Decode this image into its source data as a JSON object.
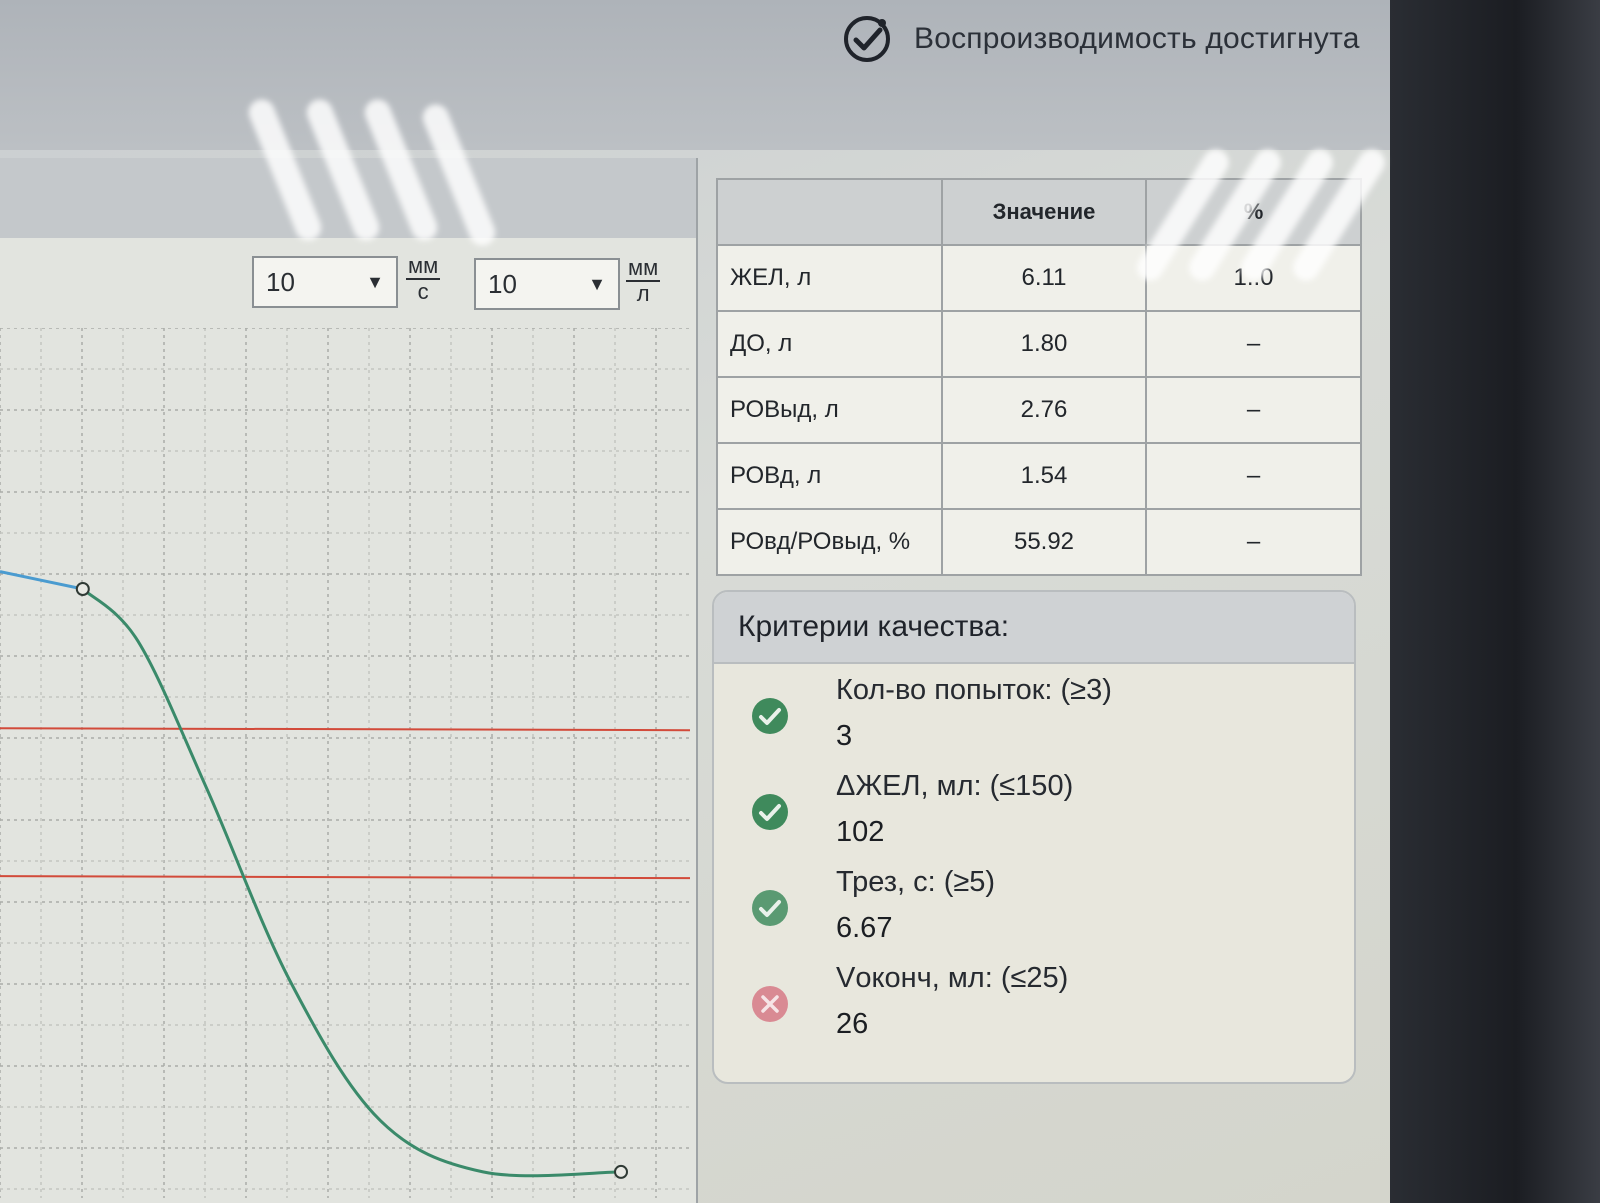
{
  "header": {
    "status_text": "Воспроизводимость достигнута",
    "status_icon": "checkmark-circle-icon"
  },
  "chart": {
    "speed_select": {
      "value": "10",
      "unit_num": "мм",
      "unit_den": "с"
    },
    "volume_select": {
      "value": "10",
      "unit_num": "мм",
      "unit_den": "л"
    }
  },
  "params_table": {
    "columns": [
      "",
      "Значение",
      "%"
    ],
    "rows": [
      {
        "name": "ЖЕЛ, л",
        "value": "6.11",
        "pct": "1..0"
      },
      {
        "name": "ДО, л",
        "value": "1.80",
        "pct": "–"
      },
      {
        "name": "РОВыд, л",
        "value": "2.76",
        "pct": "–"
      },
      {
        "name": "РОВд, л",
        "value": "1.54",
        "pct": "–"
      },
      {
        "name": "РОвд/РОвыд, %",
        "value": "55.92",
        "pct": "–"
      }
    ]
  },
  "criteria": {
    "title": "Критерии качества:",
    "items": [
      {
        "label": "Кол-во попыток: (≥3)",
        "value": "3",
        "status": "pass"
      },
      {
        "label": "ΔЖЕЛ, мл: (≤150)",
        "value": "102",
        "status": "pass"
      },
      {
        "label": "Трез, с: (≥5)",
        "value": "6.67",
        "status": "pass"
      },
      {
        "label": "Vоконч, мл: (≤25)",
        "value": "26",
        "status": "fail"
      }
    ],
    "colors": {
      "pass": "#3f8a5c",
      "fail": "#d98a93"
    }
  },
  "chart_data": {
    "type": "line",
    "series": [
      {
        "color": "#4a9bd0",
        "points": [
          [
            0,
            0.72
          ],
          [
            0.12,
            0.7
          ]
        ]
      },
      {
        "color": "#3a8a6a",
        "points": [
          [
            0.12,
            0.7
          ],
          [
            0.2,
            0.64
          ],
          [
            0.3,
            0.47
          ],
          [
            0.42,
            0.25
          ],
          [
            0.55,
            0.09
          ],
          [
            0.7,
            0.03
          ],
          [
            0.9,
            0.03
          ]
        ]
      }
    ],
    "reference_lines": {
      "color": "#d24a3a",
      "y": [
        0.54,
        0.37
      ]
    },
    "grid": true,
    "xlim": [
      0,
      1
    ],
    "ylim": [
      0,
      1
    ]
  }
}
